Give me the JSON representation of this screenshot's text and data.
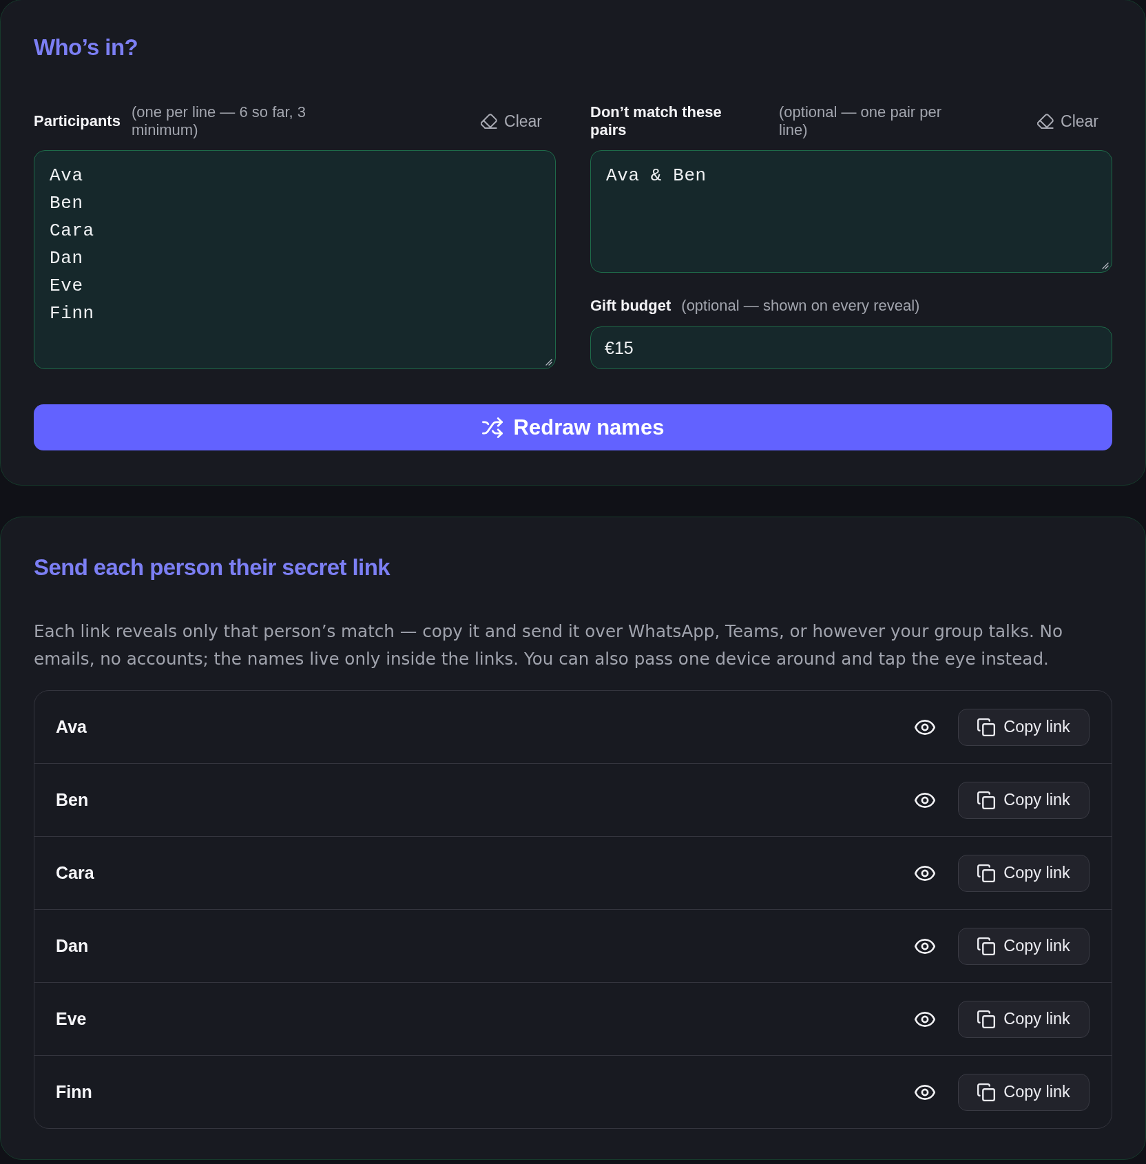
{
  "setup": {
    "title": "Who’s in?",
    "participants": {
      "label": "Participants",
      "hint": "(one per line — 6 so far, 3 minimum)",
      "clear": "Clear",
      "value": "Ava\nBen\nCara\nDan\nEve\nFinn"
    },
    "exclusions": {
      "label": "Don’t match these pairs",
      "hint": "(optional — one pair per line)",
      "clear": "Clear",
      "value": "Ava & Ben"
    },
    "budget": {
      "label": "Gift budget",
      "hint": "(optional — shown on every reveal)",
      "value": "€15"
    },
    "redraw_button": "Redraw names"
  },
  "links": {
    "title": "Send each person their secret link",
    "description": "Each link reveals only that person’s match — copy it and send it over WhatsApp, Teams, or however your group talks. No emails, no accounts; the names live only inside the links. You can also pass one device around and tap the eye instead.",
    "people": [
      {
        "name": "Ava",
        "copy_button": "Copy link"
      },
      {
        "name": "Ben",
        "copy_button": "Copy link"
      },
      {
        "name": "Cara",
        "copy_button": "Copy link"
      },
      {
        "name": "Dan",
        "copy_button": "Copy link"
      },
      {
        "name": "Eve",
        "copy_button": "Copy link"
      },
      {
        "name": "Finn",
        "copy_button": "Copy link"
      }
    ]
  }
}
